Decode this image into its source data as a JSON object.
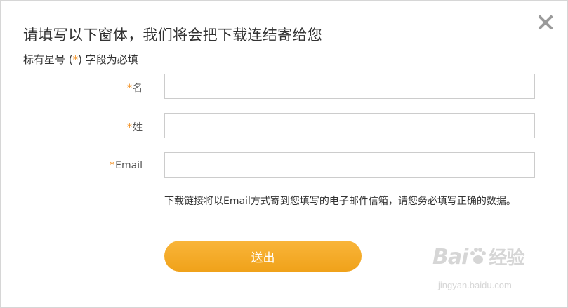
{
  "modal": {
    "title": "请填写以下窗体，我们将会把下载连结寄给您",
    "required_note_prefix": "标有星号 (",
    "required_star": "*",
    "required_note_suffix": ") 字段为必填",
    "close_icon": "close-icon"
  },
  "fields": [
    {
      "star": "*",
      "label": "名",
      "value": ""
    },
    {
      "star": "*",
      "label": "姓",
      "value": ""
    },
    {
      "star": "*",
      "label": "Email",
      "value": ""
    }
  ],
  "hint": "下载链接将以Email方式寄到您填写的电子邮件信箱，请您务必填写正确的数据。",
  "submit_label": "送出",
  "watermark": {
    "brand": "Bai",
    "brand_suffix": "经验",
    "url": "jingyan.baidu.com"
  },
  "colors": {
    "accent": "#f0a21a",
    "star": "#f28c1a"
  }
}
